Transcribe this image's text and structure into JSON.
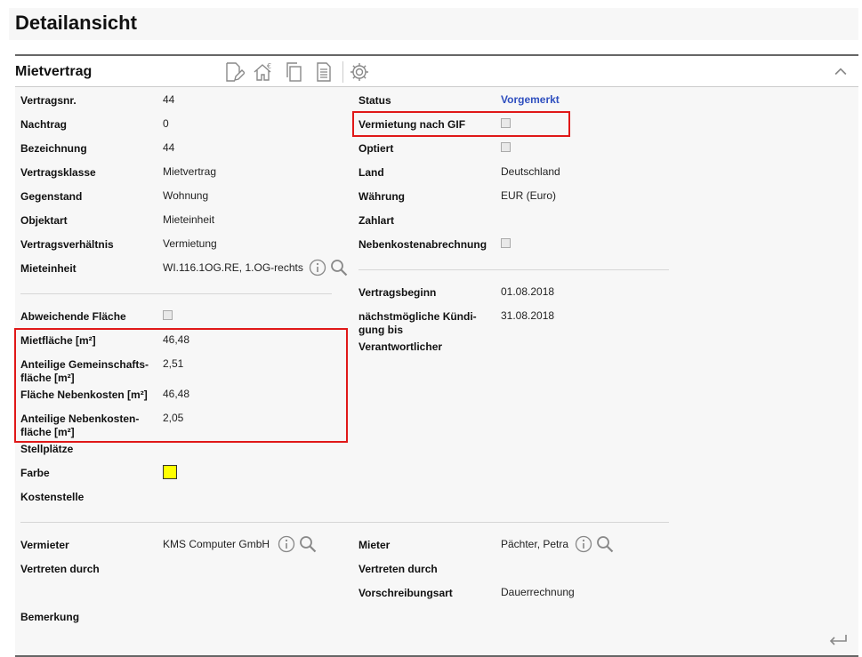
{
  "page": {
    "title": "Detailansicht"
  },
  "panel": {
    "title": "Mietvertrag"
  },
  "left": {
    "vertragsnr": {
      "label": "Vertragsnr.",
      "value": "44"
    },
    "nachtrag": {
      "label": "Nachtrag",
      "value": "0"
    },
    "bezeichnung": {
      "label": "Bezeichnung",
      "value": "44"
    },
    "vertragsklasse": {
      "label": "Vertragsklasse",
      "value": "Mietvertrag"
    },
    "gegenstand": {
      "label": "Gegenstand",
      "value": "Wohnung"
    },
    "objektart": {
      "label": "Objektart",
      "value": "Mieteinheit"
    },
    "vertragsverhaeltnis": {
      "label": "Vertragsverhältnis",
      "value": "Vermietung"
    },
    "mieteinheit": {
      "label": "Mieteinheit",
      "value": "WI.116.1OG.RE, 1.OG-rechts"
    },
    "abweichende_flaeche": {
      "label": "Abweichende Fläche"
    },
    "mietflaeche": {
      "label": "Mietfläche [m²]",
      "value": "46,48"
    },
    "anteilige_gemeinschaftsflaeche": {
      "label1": "Anteilige Gemeinschafts-",
      "label2": "fläche [m²]",
      "value": "2,51"
    },
    "flaeche_nebenkosten": {
      "label": "Fläche Nebenkosten [m²]",
      "value": "46,48"
    },
    "anteilige_nebenkostenflaeche": {
      "label1": "Anteilige Nebenkosten-",
      "label2": "fläche [m²]",
      "value": "2,05"
    },
    "stellplaetze": {
      "label": "Stellplätze"
    },
    "farbe": {
      "label": "Farbe",
      "color": "#ffff00"
    },
    "kostenstelle": {
      "label": "Kostenstelle"
    }
  },
  "right": {
    "status": {
      "label": "Status",
      "value": "Vorgemerkt"
    },
    "vermietung_gif": {
      "label": "Vermietung nach GIF"
    },
    "optiert": {
      "label": "Optiert"
    },
    "land": {
      "label": "Land",
      "value": "Deutschland"
    },
    "waehrung": {
      "label": "Währung",
      "value": "EUR (Euro)"
    },
    "zahlart": {
      "label": "Zahlart"
    },
    "nebenkostenabrechnung": {
      "label": "Nebenkostenabrechnung"
    },
    "vertragsbeginn": {
      "label": "Vertragsbeginn",
      "value": "01.08.2018"
    },
    "kuendigung": {
      "label1": "nächstmögliche Kündi-",
      "label2": "gung bis",
      "value": "31.08.2018"
    },
    "verantwortlicher": {
      "label": "Verantwortlicher"
    }
  },
  "parties": {
    "vermieter": {
      "label": "Vermieter",
      "value": "KMS Computer GmbH"
    },
    "vertreten_left": {
      "label": "Vertreten durch"
    },
    "bemerkung": {
      "label": "Bemerkung"
    },
    "mieter": {
      "label": "Mieter",
      "value": "Pächter, Petra"
    },
    "vertreten_right": {
      "label": "Vertreten durch"
    },
    "vorschreibungsart": {
      "label": "Vorschreibungsart",
      "value": "Dauerrechnung"
    }
  },
  "colors": {
    "highlight": "#e01818",
    "status_blue": "#2f4fbf"
  }
}
